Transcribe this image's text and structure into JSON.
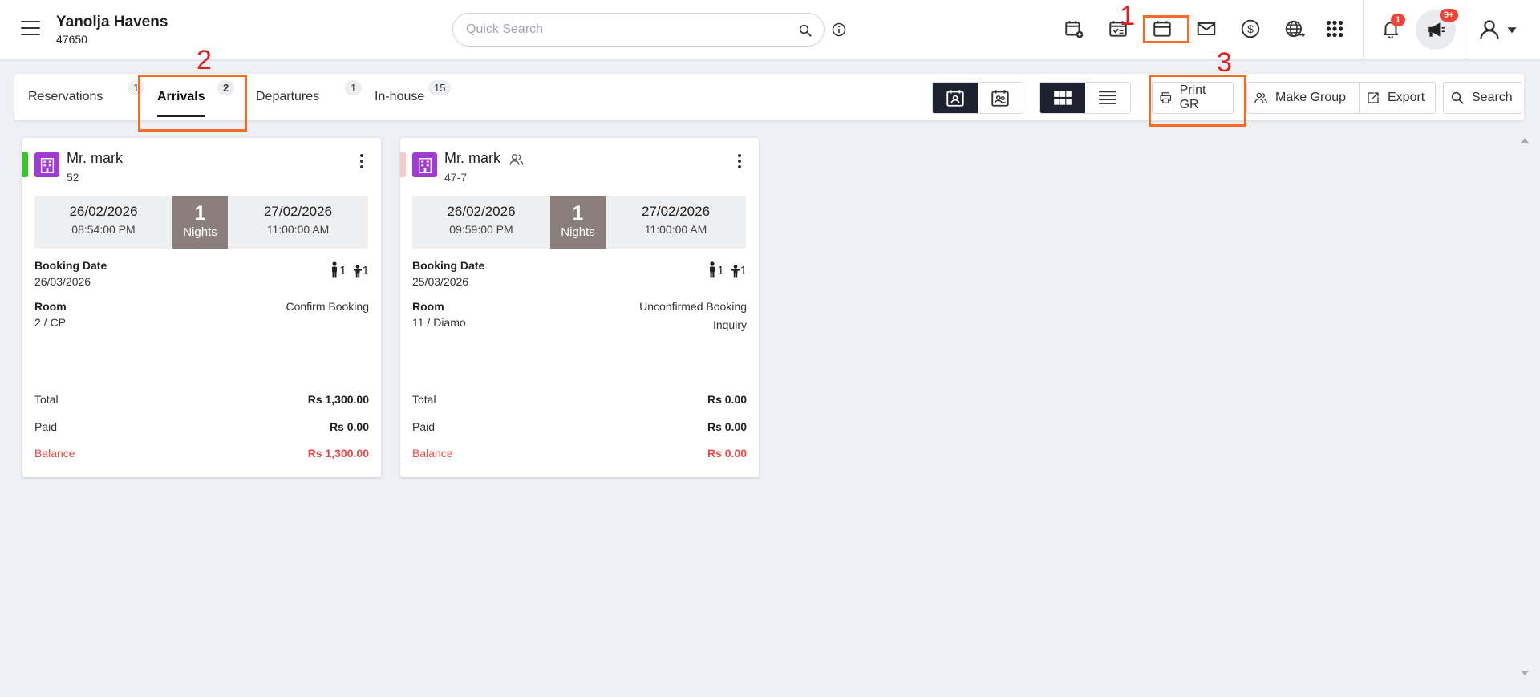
{
  "header": {
    "hotel_name": "Yanolja Havens",
    "hotel_id": "47650",
    "search_placeholder": "Quick Search",
    "notification_count": "1",
    "announcement_count": "9+"
  },
  "tabs": [
    {
      "label": "Reservations",
      "count": "1"
    },
    {
      "label": "Arrivals",
      "count": "2"
    },
    {
      "label": "Departures",
      "count": "1"
    },
    {
      "label": "In-house",
      "count": "15"
    }
  ],
  "actions": {
    "print_gr": "Print GR",
    "make_group": "Make Group",
    "export": "Export",
    "search": "Search"
  },
  "annotations": {
    "one": "1",
    "two": "2",
    "three": "3"
  },
  "labels": {
    "booking_date": "Booking Date",
    "room": "Room",
    "nights": "Nights",
    "total": "Total",
    "paid": "Paid",
    "balance": "Balance"
  },
  "cards": [
    {
      "guest": "Mr. mark",
      "reservation_no": "52",
      "status_color": "#2ecc1e",
      "arrival_date": "26/02/2026",
      "arrival_time": "08:54:00 PM",
      "nights": "1",
      "departure_date": "27/02/2026",
      "departure_time": "11:00:00 AM",
      "booking_date": "26/03/2026",
      "adults": "1",
      "children": "1",
      "room": "2 / CP",
      "status": "Confirm Booking",
      "status2": "",
      "total": "Rs 1,300.00",
      "paid": "Rs 0.00",
      "balance": "Rs 1,300.00"
    },
    {
      "guest": "Mr. mark",
      "reservation_no": "47-7",
      "status_color": "#f7c9c9",
      "arrival_date": "26/02/2026",
      "arrival_time": "09:59:00 PM",
      "nights": "1",
      "departure_date": "27/02/2026",
      "departure_time": "11:00:00 AM",
      "booking_date": "25/03/2026",
      "adults": "1",
      "children": "1",
      "room": "11 / Diamo",
      "status": "Unconfirmed Booking",
      "status2": "Inquiry",
      "total": "Rs 0.00",
      "paid": "Rs 0.00",
      "balance": "Rs 0.00"
    }
  ],
  "colors": {
    "accent_dark": "#1e2230",
    "highlight": "#f26b2a",
    "annotation_text": "#e02020",
    "balance_red": "#f04747",
    "building_icon": "#a23ad4"
  }
}
